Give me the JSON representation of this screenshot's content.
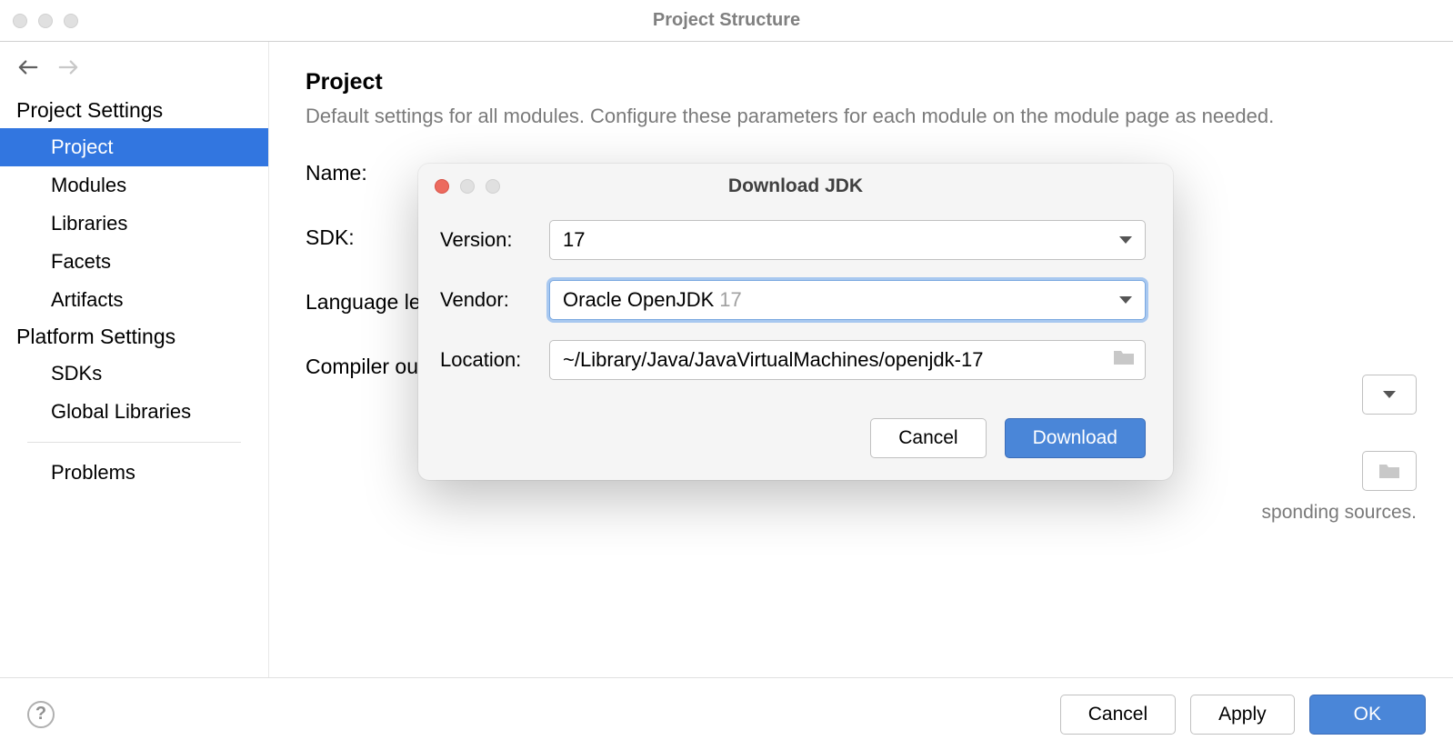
{
  "window": {
    "title": "Project Structure"
  },
  "sidebar": {
    "section1_heading": "Project Settings",
    "section1_items": [
      "Project",
      "Modules",
      "Libraries",
      "Facets",
      "Artifacts"
    ],
    "section2_heading": "Platform Settings",
    "section2_items": [
      "SDKs",
      "Global Libraries"
    ],
    "problems": "Problems"
  },
  "main": {
    "heading": "Project",
    "subtitle": "Default settings for all modules. Configure these parameters for each module on the module page as needed.",
    "labels": {
      "name": "Name:",
      "sdk": "SDK:",
      "language_level": "Language le",
      "compiler_output": "Compiler ou"
    },
    "hint_fragment": "sponding sources."
  },
  "footer": {
    "cancel": "Cancel",
    "apply": "Apply",
    "ok": "OK"
  },
  "modal": {
    "title": "Download JDK",
    "labels": {
      "version": "Version:",
      "vendor": "Vendor:",
      "location": "Location:"
    },
    "version_value": "17",
    "vendor_value": "Oracle OpenJDK",
    "vendor_suffix": "17",
    "location_value": "~/Library/Java/JavaVirtualMachines/openjdk-17",
    "buttons": {
      "cancel": "Cancel",
      "download": "Download"
    }
  }
}
